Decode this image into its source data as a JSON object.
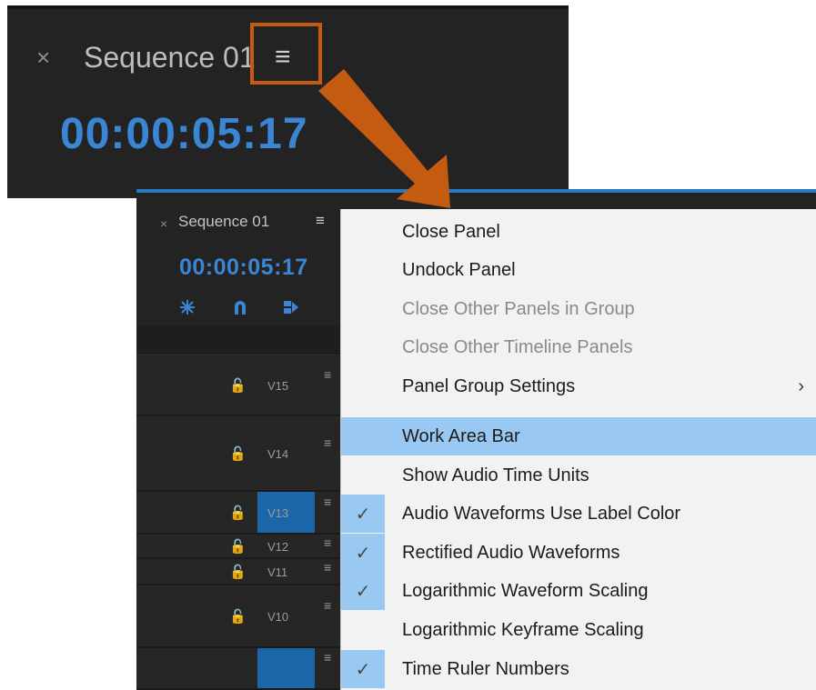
{
  "zoom": {
    "close_glyph": "×",
    "title": "Sequence 01",
    "menu_glyph": "≡",
    "timecode": "00:00:05:17"
  },
  "timeline": {
    "close_glyph": "×",
    "title": "Sequence 01",
    "menu_glyph": "≡",
    "timecode": "00:00:05:17",
    "tools": [
      "insert-overwrite-icon",
      "snap-magnet-icon",
      "linked-selection-icon"
    ],
    "tracks": [
      {
        "label": "V15",
        "targeted": false
      },
      {
        "label": "V14",
        "targeted": false
      },
      {
        "label": "V13",
        "targeted": true
      },
      {
        "label": "V12",
        "targeted": false
      },
      {
        "label": "V11",
        "targeted": false
      },
      {
        "label": "V10",
        "targeted": false
      },
      {
        "label": "",
        "targeted": true
      }
    ],
    "lock_glyph": "🔓",
    "toggle_glyph": "≡"
  },
  "menu": {
    "items": [
      {
        "label": "Close Panel",
        "disabled": false,
        "checked": false,
        "hovered": false,
        "submenu": false
      },
      {
        "label": "Undock Panel",
        "disabled": false,
        "checked": false,
        "hovered": false,
        "submenu": false
      },
      {
        "label": "Close Other Panels in Group",
        "disabled": true,
        "checked": false,
        "hovered": false,
        "submenu": false
      },
      {
        "label": "Close Other Timeline Panels",
        "disabled": true,
        "checked": false,
        "hovered": false,
        "submenu": false
      },
      {
        "label": "Panel Group Settings",
        "disabled": false,
        "checked": false,
        "hovered": false,
        "submenu": true
      },
      {
        "label": "Work Area Bar",
        "disabled": false,
        "checked": false,
        "hovered": true,
        "submenu": false
      },
      {
        "label": "Show Audio Time Units",
        "disabled": false,
        "checked": false,
        "hovered": false,
        "submenu": false
      },
      {
        "label": "Audio Waveforms Use Label Color",
        "disabled": false,
        "checked": true,
        "hovered": false,
        "submenu": false
      },
      {
        "label": "Rectified Audio Waveforms",
        "disabled": false,
        "checked": true,
        "hovered": false,
        "submenu": false
      },
      {
        "label": "Logarithmic Waveform Scaling",
        "disabled": false,
        "checked": true,
        "hovered": false,
        "submenu": false
      },
      {
        "label": "Logarithmic Keyframe Scaling",
        "disabled": false,
        "checked": false,
        "hovered": false,
        "submenu": false
      },
      {
        "label": "Time Ruler Numbers",
        "disabled": false,
        "checked": true,
        "hovered": false,
        "submenu": false
      }
    ],
    "check_glyph": "✓",
    "submenu_glyph": "›"
  },
  "colors": {
    "panel_bg": "#232323",
    "timecode_blue": "#3a86d4",
    "highlight_orange": "#c55a11",
    "menu_hover": "#99c9f3",
    "track_target": "#1a66a8"
  }
}
